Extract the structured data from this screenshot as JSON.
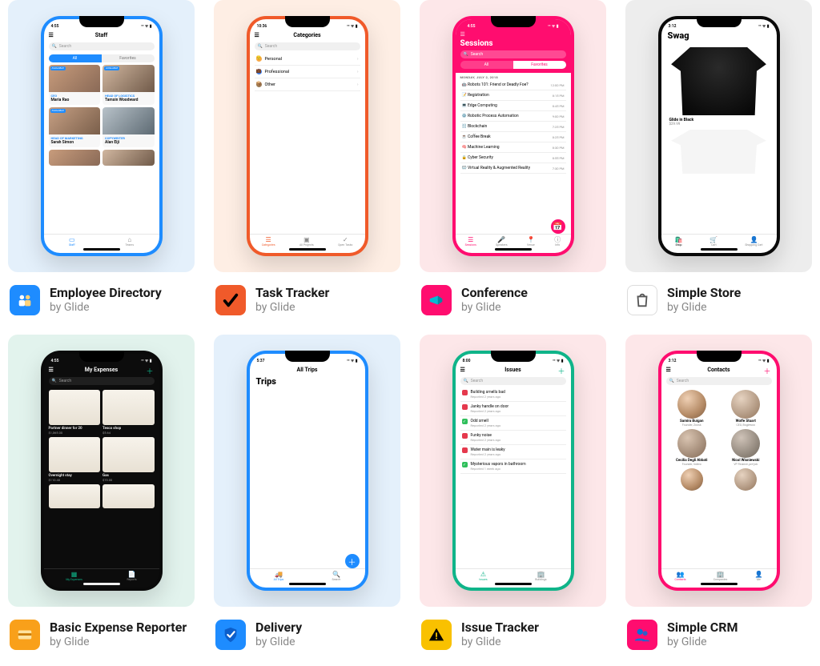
{
  "byline": "by Glide",
  "cards": [
    {
      "title": "Employee Directory",
      "iconBg": "#1e8cff",
      "iconKind": "people"
    },
    {
      "title": "Task Tracker",
      "iconBg": "#f05a2a",
      "iconKind": "check"
    },
    {
      "title": "Conference",
      "iconBg": "#ff0d6f",
      "iconKind": "megaphone"
    },
    {
      "title": "Simple Store",
      "iconBg": "#ffffff",
      "iconKind": "bag",
      "iconBorder": "#d6d6d6",
      "iconFg": "#555"
    },
    {
      "title": "Basic Expense Reporter",
      "iconBg": "#f9a01a",
      "iconKind": "card"
    },
    {
      "title": "Delivery",
      "iconBg": "#1e8cff",
      "iconKind": "shield"
    },
    {
      "title": "Issue Tracker",
      "iconBg": "#f9c100",
      "iconKind": "warn",
      "iconFg": "#000"
    },
    {
      "title": "Simple CRM",
      "iconBg": "#ff0d6f",
      "iconKind": "users"
    }
  ],
  "phones": {
    "statusTime": "4:55",
    "statusTimeAlt": "3:12",
    "statusTimeAlt2": "10:36",
    "statusTimeAlt3": "5:37",
    "statusTimeAlt4": "8:00",
    "searchPlaceholder": "Search",
    "segAll": "All",
    "segFav": "Favorites",
    "employeeDirectory": {
      "navTitle": "Staff",
      "items": [
        {
          "role": "CEO",
          "name": "Maria Rao",
          "badge": "AVAILABLE"
        },
        {
          "role": "HEAD OF LOGISTICS",
          "name": "Tamsin Woodward",
          "badge": "AVAILABLE"
        },
        {
          "role": "HEAD OF MARKETING",
          "name": "Sarah Simon",
          "badge": "AVAILABLE"
        },
        {
          "role": "COPYWRITER",
          "name": "Alan Eiji"
        }
      ],
      "tabs": [
        "Staff",
        "Teams"
      ]
    },
    "taskTracker": {
      "navTitle": "Categories",
      "items": [
        "Personal",
        "Professional",
        "Other"
      ],
      "tabs": [
        "Categories",
        "All Projects",
        "Open Tasks"
      ]
    },
    "conference": {
      "navTitle": "Sessions",
      "date": "MONDAY, JULY 2, 2018",
      "sessions": [
        {
          "t": "Robots 101: Friend or Deadly Foe?",
          "time": "12:00 PM"
        },
        {
          "t": "Registration",
          "time": "8:15 PM"
        },
        {
          "t": "Edge Computing",
          "time": "8:45 PM"
        },
        {
          "t": "Robotic Process Automation",
          "time": "9:00 PM"
        },
        {
          "t": "Blockchain",
          "time": "7:25 PM"
        },
        {
          "t": "Coffee Break",
          "time": "8:25 PM"
        },
        {
          "t": "Machine Learning",
          "time": "8:30 PM"
        },
        {
          "t": "Cyber Security",
          "time": "8:55 PM"
        },
        {
          "t": "Virtual Reality & Augmented Reality",
          "time": "7:30 PM"
        }
      ],
      "tabs": [
        "Sessions",
        "Speakers",
        "Venue",
        "Info"
      ]
    },
    "store": {
      "navTitle": "Swag",
      "item1": {
        "name": "Glide in Black",
        "price": "$29.99"
      },
      "tabs": [
        "Shop",
        "Cart",
        "Shopping Cart"
      ]
    },
    "expenses": {
      "navTitle": "My Expenses",
      "items": [
        {
          "name": "Partner dinner for 20",
          "amt": "$1,065.00"
        },
        {
          "name": "Tesco shop",
          "amt": "$5.64"
        },
        {
          "name": "Overnight stay",
          "amt": "$110.48"
        },
        {
          "name": "Gas",
          "amt": "$70.00"
        }
      ],
      "tabs": [
        "My Expenses",
        "Reports"
      ]
    },
    "delivery": {
      "navTitle": "All Trips",
      "bigTitle": "Trips",
      "tabs": [
        "All Trips",
        "Search"
      ]
    },
    "issues": {
      "navTitle": "Issues",
      "items": [
        {
          "t": "Building smells bad",
          "sub": "Reported 2 years ago",
          "status": "red"
        },
        {
          "t": "Janky handle on door",
          "sub": "Reported 2 years ago",
          "status": "red"
        },
        {
          "t": "Odd smell",
          "sub": "Reported 2 years ago",
          "status": "green"
        },
        {
          "t": "Funky noise",
          "sub": "Reported 2 years ago",
          "status": "red"
        },
        {
          "t": "Water main is leaky",
          "sub": "Reported 2 years ago",
          "status": "red"
        },
        {
          "t": "Mysterious vapors in bathroom",
          "sub": "Reported 1 week ago",
          "status": "green"
        }
      ],
      "tabs": [
        "Issues",
        "Buildings"
      ]
    },
    "crm": {
      "navTitle": "Contacts",
      "contacts": [
        {
          "name": "Samira Buigan",
          "role": "Founder, Zoosk"
        },
        {
          "name": "Wolfe Stuart",
          "role": "CEO, Boglewoo"
        },
        {
          "name": "Cecilia Degli Abbati",
          "role": "Founder, Indero"
        },
        {
          "name": "Nicol Wisniewski",
          "role": "VP Finance, pre-job"
        }
      ],
      "tabs": [
        "Contacts",
        "Companies",
        "Me"
      ]
    }
  }
}
